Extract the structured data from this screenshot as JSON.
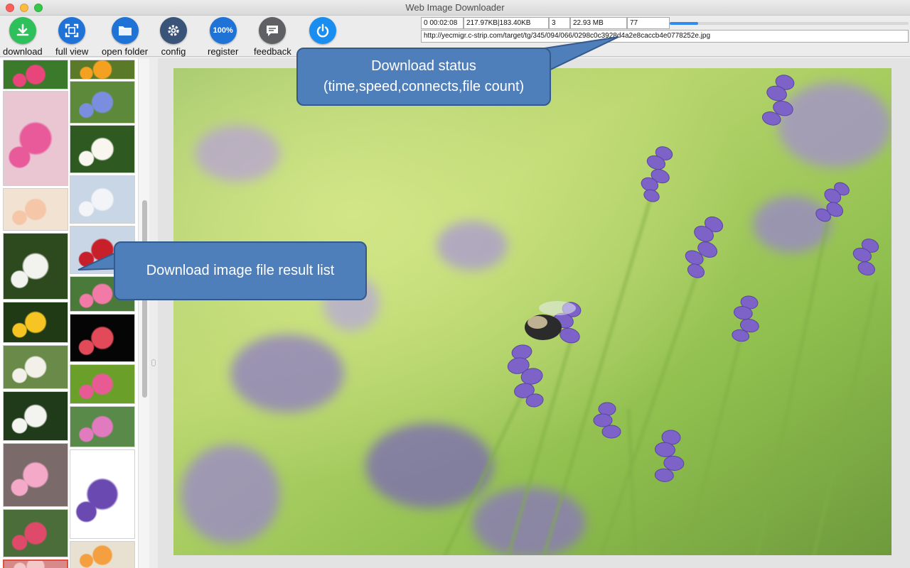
{
  "window": {
    "title": "Web Image Downloader"
  },
  "toolbar": {
    "buttons": [
      {
        "label": "download",
        "icon": "download-icon",
        "color": "#2ec05a"
      },
      {
        "label": "full view",
        "icon": "fullscreen-icon",
        "color": "#1f73d6"
      },
      {
        "label": "open folder",
        "icon": "folder-icon",
        "color": "#1f73d6"
      },
      {
        "label": "config",
        "icon": "gear-icon",
        "color": "#3a5378"
      },
      {
        "label": "register",
        "icon": "register-icon",
        "badge": "100%",
        "color": "#1f73d6"
      },
      {
        "label": "feedback",
        "icon": "chat-icon",
        "color": "#5e6063"
      },
      {
        "label": "",
        "icon": "power-icon",
        "color": "#1a8ef0"
      }
    ]
  },
  "status": {
    "time": "0 00:02:08",
    "speed": "217.97KB|183.40KB",
    "connects": "3",
    "size": "22.93 MB",
    "file_count": "77",
    "progress": 0.12,
    "url": "http://yecmigr.c-strip.com/target/tg/345/094/066/0298c0c3928d4a2e8caccb4e0778252e.jpg"
  },
  "callouts": {
    "status_line1": "Download status",
    "status_line2": "(time,speed,connects,file count)",
    "list": "Download image file result list"
  },
  "colors": {
    "accent": "#2e8cf0",
    "callout": "#4f7fba"
  }
}
